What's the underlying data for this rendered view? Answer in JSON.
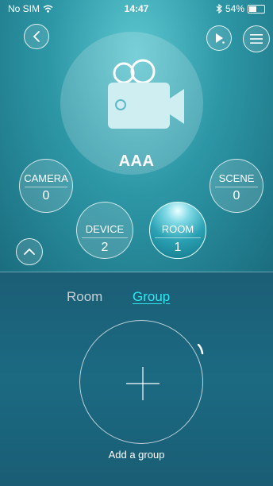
{
  "status_bar": {
    "carrier": "No SIM",
    "time": "14:47",
    "battery": "54%",
    "icons": [
      "wifi-icon",
      "bluetooth-icon",
      "battery-icon"
    ]
  },
  "header": {
    "back_icon": "chevron-left-icon",
    "play_icon": "play-icon",
    "menu_icon": "menu-icon"
  },
  "hero": {
    "icon": "video-camera-icon",
    "title": "AAA"
  },
  "stats": {
    "camera": {
      "label": "CAMERA",
      "value": "0"
    },
    "scene": {
      "label": "SCENE",
      "value": "0"
    },
    "device": {
      "label": "DEVICE",
      "value": "2"
    },
    "room": {
      "label": "ROOM",
      "value": "1"
    }
  },
  "collapse_icon": "chevron-up-icon",
  "tabs": {
    "room": "Room",
    "group": "Group",
    "active": "Group"
  },
  "add_group": {
    "icon": "plus-icon",
    "label": "Add a group"
  },
  "colors": {
    "accent": "#2ee7f2",
    "top_bg": "#2d97a6",
    "bottom_bg": "#1b6a82"
  }
}
